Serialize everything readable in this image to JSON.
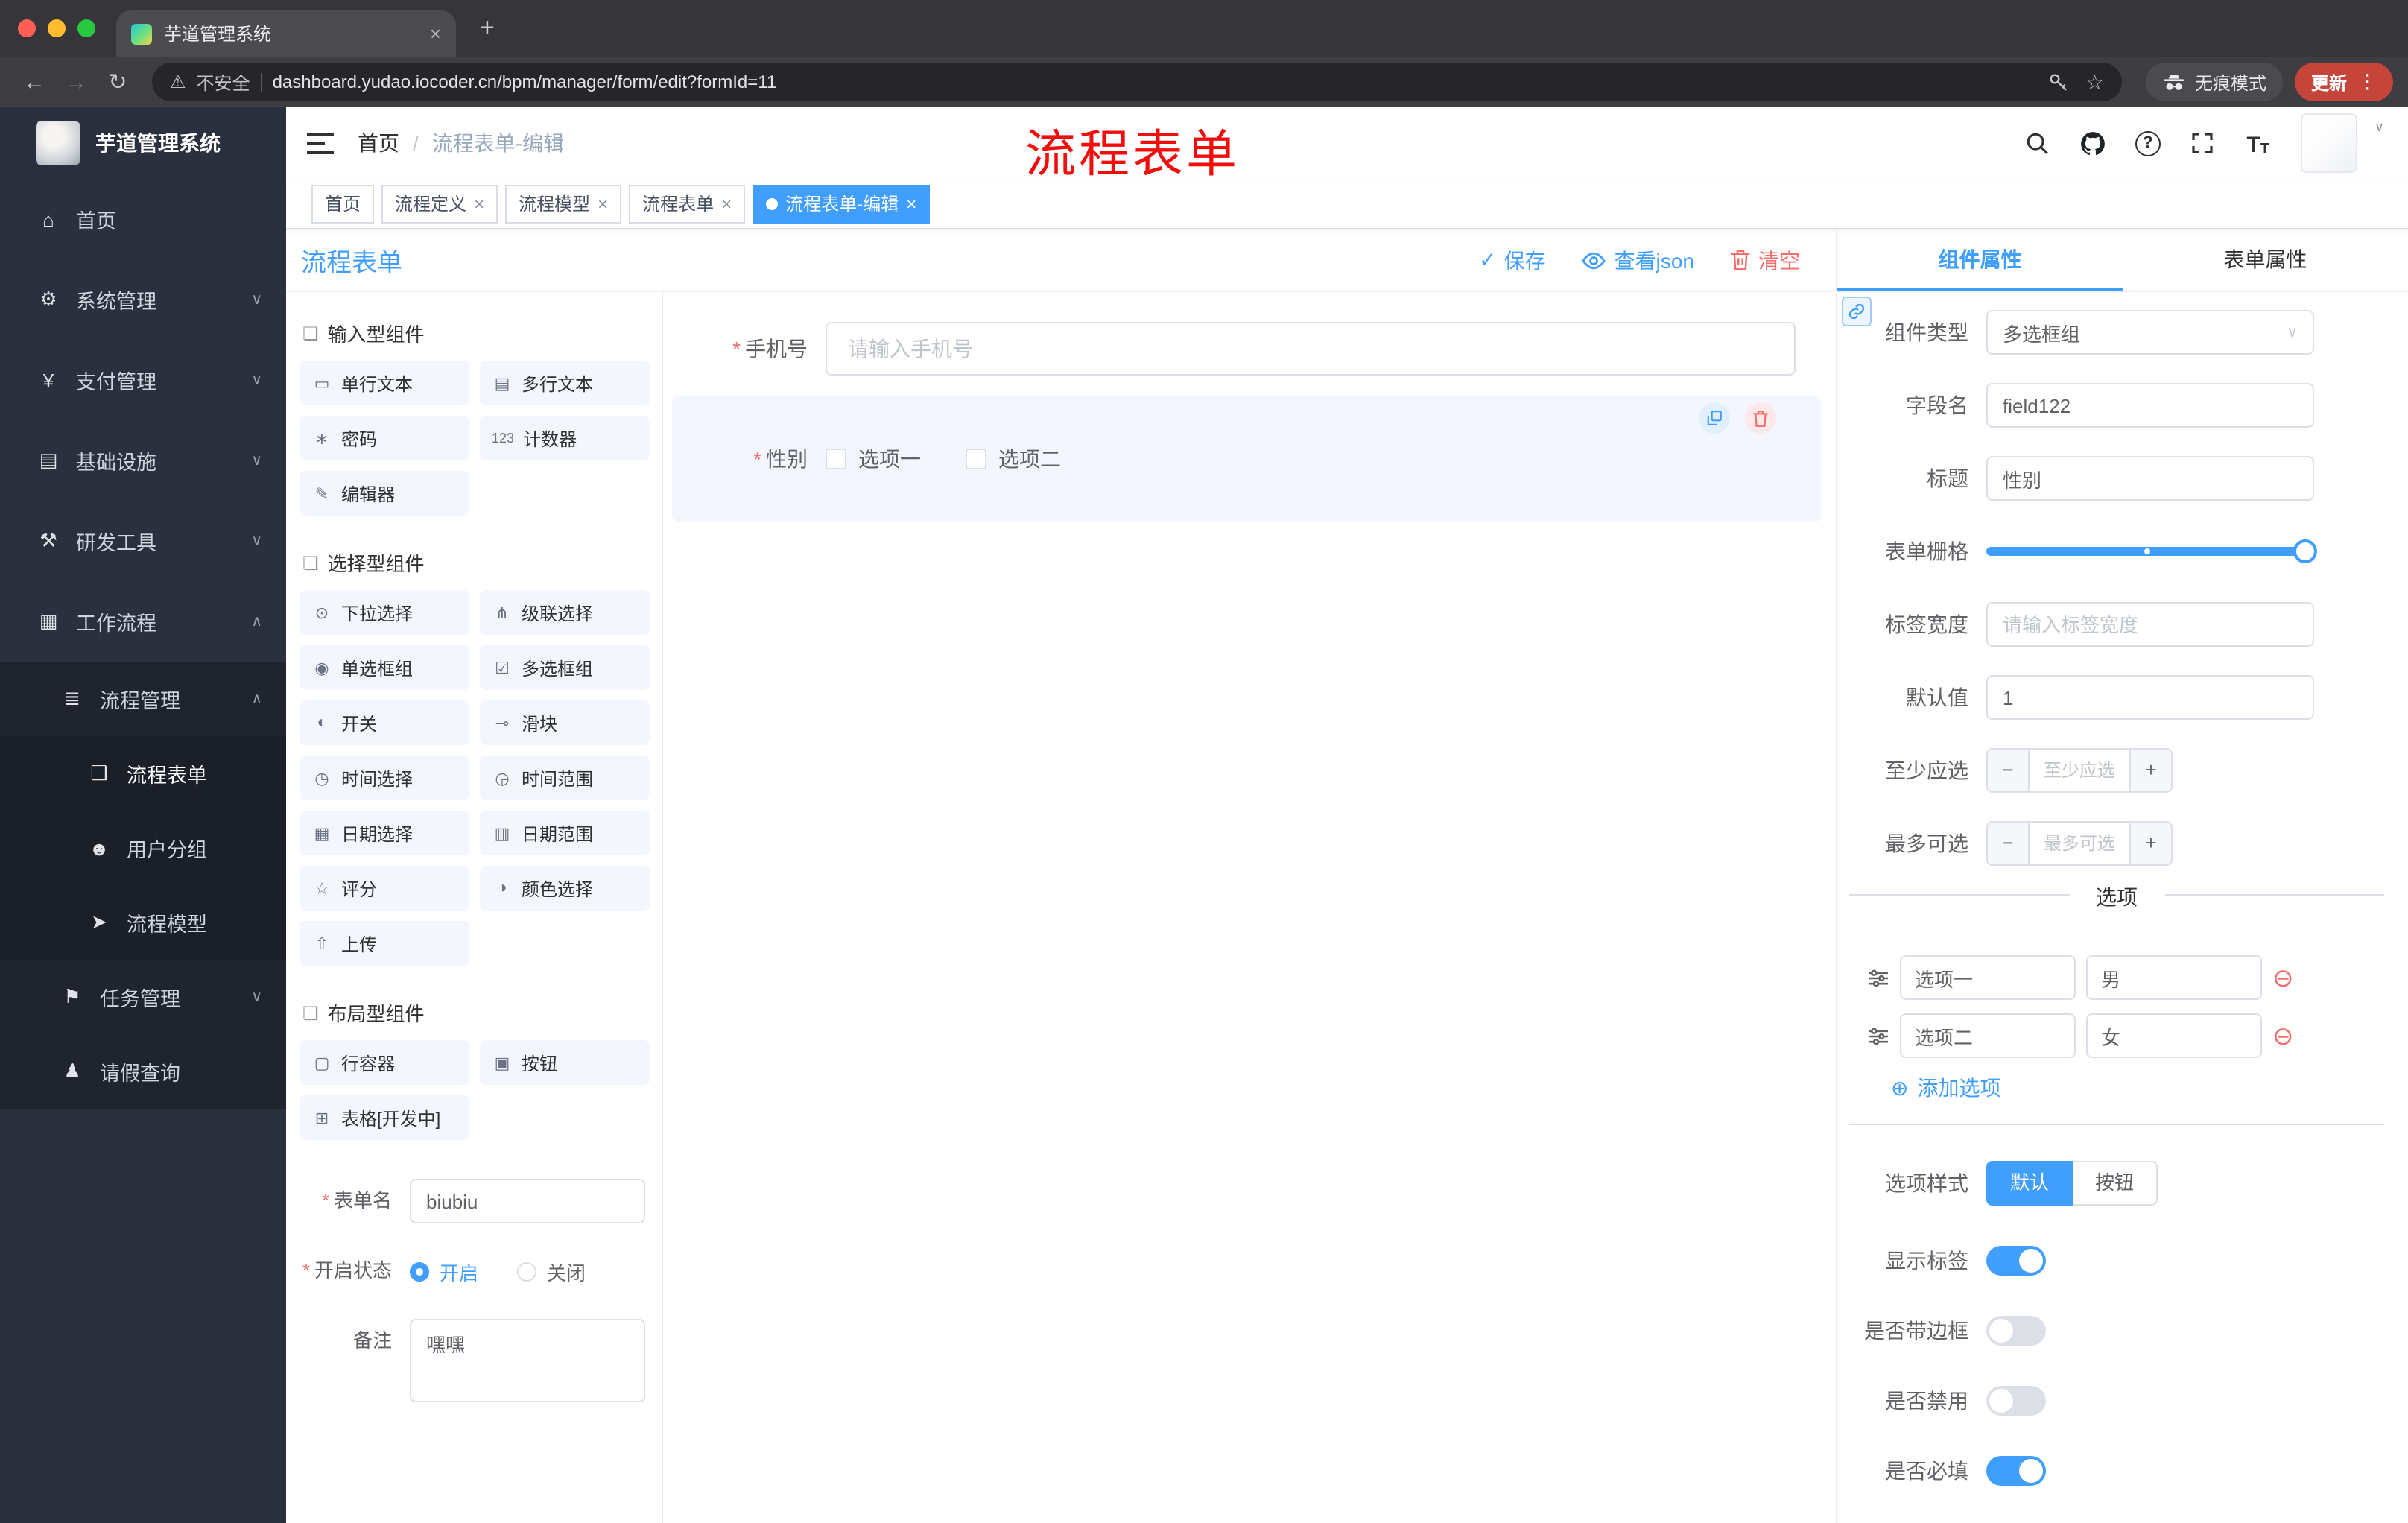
{
  "colors": {
    "accent": "#409eff",
    "danger": "#f56c6c",
    "annotation": "#f20d0d",
    "update_chip": "#c5453a",
    "tag_active": "#409eff"
  },
  "icons": {
    "close": "×",
    "plus": "+",
    "back": "←",
    "forward": "→",
    "reload": "↻",
    "warning": "⚠",
    "star": "☆",
    "menu_dots": "⋮",
    "chevron_down": "∨",
    "chevron_up": "∧",
    "breadcrumb_sep": "/",
    "check": "✓",
    "minus": "−",
    "add_circle": "⊕",
    "remove_circle": "⊖",
    "section": "❏",
    "caret": "∨",
    "select_arrow": "∨",
    "question": "?",
    "font_size_big": "T",
    "font_size_small": "T"
  },
  "browser": {
    "tab_title": "芋道管理系统",
    "security_label": "不安全",
    "url": "dashboard.yudao.iocoder.cn/bpm/manager/form/edit?formId=11",
    "incognito_label": "无痕模式",
    "update_label": "更新"
  },
  "sidebar": {
    "logo_title": "芋道管理系统",
    "items": [
      {
        "icon": "⌂",
        "label": "首页"
      },
      {
        "icon": "⚙",
        "label": "系统管理"
      },
      {
        "icon": "¥",
        "label": "支付管理"
      },
      {
        "icon": "▤",
        "label": "基础设施"
      },
      {
        "icon": "⚒",
        "label": "研发工具"
      },
      {
        "icon": "▦",
        "label": "工作流程"
      },
      {
        "icon": "≣",
        "label": "流程管理"
      },
      {
        "icon": "❑",
        "label": "流程表单"
      },
      {
        "icon": "☻",
        "label": "用户分组"
      },
      {
        "icon": "➤",
        "label": "流程模型"
      },
      {
        "icon": "⚑",
        "label": "任务管理"
      },
      {
        "icon": "♟",
        "label": "请假查询"
      }
    ]
  },
  "header": {
    "breadcrumb": [
      "首页",
      "流程表单-编辑"
    ],
    "annotation": "流程表单"
  },
  "tags": [
    {
      "label": "首页"
    },
    {
      "label": "流程定义"
    },
    {
      "label": "流程模型"
    },
    {
      "label": "流程表单"
    },
    {
      "label": "流程表单-编辑"
    }
  ],
  "designer": {
    "title": "流程表单",
    "toolbar": {
      "save": "保存",
      "view_json": "查看json",
      "clear": "清空"
    },
    "palette": [
      {
        "title": "输入型组件",
        "items": [
          {
            "icon": "▭",
            "label": "单行文本"
          },
          {
            "icon": "▤",
            "label": "多行文本"
          },
          {
            "icon": "∗",
            "label": "密码"
          },
          {
            "icon": "123",
            "label": "计数器"
          },
          {
            "icon": "✎",
            "label": "编辑器"
          }
        ]
      },
      {
        "title": "选择型组件",
        "items": [
          {
            "icon": "⊙",
            "label": "下拉选择"
          },
          {
            "icon": "⋔",
            "label": "级联选择"
          },
          {
            "icon": "◉",
            "label": "单选框组"
          },
          {
            "icon": "☑",
            "label": "多选框组"
          },
          {
            "icon": "◐",
            "label": "开关"
          },
          {
            "icon": "⊸",
            "label": "滑块"
          },
          {
            "icon": "◷",
            "label": "时间选择"
          },
          {
            "icon": "◶",
            "label": "时间范围"
          },
          {
            "icon": "▦",
            "label": "日期选择"
          },
          {
            "icon": "▥",
            "label": "日期范围"
          },
          {
            "icon": "☆",
            "label": "评分"
          },
          {
            "icon": "◑",
            "label": "颜色选择"
          },
          {
            "icon": "⇧",
            "label": "上传"
          }
        ]
      },
      {
        "title": "布局型组件",
        "items": [
          {
            "icon": "▢",
            "label": "行容器"
          },
          {
            "icon": "▣",
            "label": "按钮"
          },
          {
            "icon": "⊞",
            "label": "表格[开发中]"
          }
        ]
      }
    ],
    "form_meta": {
      "name_label": "表单名",
      "name_value": "biubiu",
      "status_label": "开启状态",
      "status_on": "开启",
      "status_off": "关闭",
      "status_selected": "开启",
      "remark_label": "备注",
      "remark_value": "嘿嘿"
    },
    "canvas": {
      "phone_label": "手机号",
      "phone_placeholder": "请输入手机号",
      "gender_label": "性别",
      "gender_options": [
        "选项一",
        "选项二"
      ]
    }
  },
  "properties": {
    "tabs": [
      "组件属性",
      "表单属性"
    ],
    "active_tab": "组件属性",
    "fields": {
      "component_type_label": "组件类型",
      "component_type_value": "多选框组",
      "field_name_label": "字段名",
      "field_name_value": "field122",
      "title_label": "标题",
      "title_value": "性别",
      "grid_label": "表单栅格",
      "label_width_label": "标签宽度",
      "label_width_placeholder": "请输入标签宽度",
      "default_label": "默认值",
      "default_value": "1",
      "min_label": "至少应选",
      "min_placeholder": "至少应选",
      "max_label": "最多可选",
      "max_placeholder": "最多可选"
    },
    "options_divider": "选项",
    "options": [
      {
        "label": "选项一",
        "value": "男"
      },
      {
        "label": "选项二",
        "value": "女"
      }
    ],
    "add_option": "添加选项",
    "option_style": {
      "label": "选项样式",
      "options": [
        "默认",
        "按钮"
      ],
      "selected": "默认"
    },
    "toggles": [
      {
        "label": "显示标签",
        "on": true
      },
      {
        "label": "是否带边框",
        "on": false
      },
      {
        "label": "是否禁用",
        "on": false
      },
      {
        "label": "是否必填",
        "on": true
      }
    ]
  }
}
